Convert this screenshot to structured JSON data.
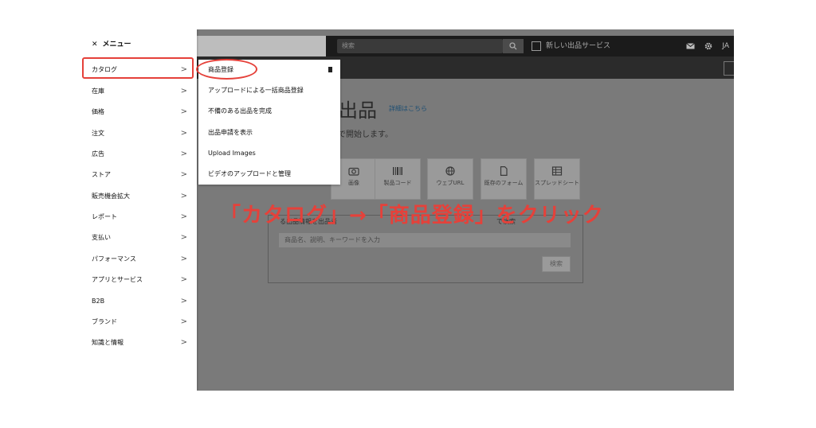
{
  "menu": {
    "close_icon": "close-icon",
    "title": "メニュー",
    "items": [
      {
        "label": "カタログ"
      },
      {
        "label": "在庫"
      },
      {
        "label": "価格"
      },
      {
        "label": "注文"
      },
      {
        "label": "広告"
      },
      {
        "label": "ストア"
      },
      {
        "label": "販売機会拡大"
      },
      {
        "label": "レポート"
      },
      {
        "label": "支払い"
      },
      {
        "label": "パフォーマンス"
      },
      {
        "label": "アプリとサービス"
      },
      {
        "label": "B2B"
      },
      {
        "label": "ブランド"
      },
      {
        "label": "知識と情報"
      }
    ],
    "chevron": ">"
  },
  "submenu": {
    "items": [
      {
        "label": "商品登録"
      },
      {
        "label": "アップロードによる一括商品登録"
      },
      {
        "label": "不備のある出品を完成"
      },
      {
        "label": "出品申請を表示"
      },
      {
        "label": "Upload Images"
      },
      {
        "label": "ビデオのアップロードと管理"
      }
    ]
  },
  "topbar": {
    "search_placeholder": "検索",
    "new_service": "新しい出品サービス",
    "language": "JA"
  },
  "main": {
    "title": "出品",
    "title_link": "詳細はこちら",
    "description": "で開始します。",
    "tiles": [
      {
        "label": "画像",
        "icon": "camera-icon"
      },
      {
        "label": "製品コード",
        "icon": "barcode-icon"
      },
      {
        "label": "ウェブURL",
        "icon": "globe-icon"
      },
      {
        "label": "既存のフォーム",
        "icon": "document-icon"
      },
      {
        "label": "スプレッドシート",
        "icon": "spreadsheet-icon"
      }
    ],
    "search_hint": "る出品情報を出品者",
    "search_hint_tail": "で検索",
    "search_placeholder": "商品名、説明、キーワードを入力",
    "search_button": "検索"
  },
  "annotation": {
    "instruction": "「カタログ」→「商品登録」をクリック",
    "color": "#e5413a"
  }
}
